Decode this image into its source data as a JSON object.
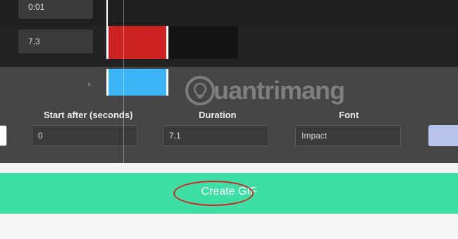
{
  "timeline": {
    "start_time": "0:01",
    "end_time": "7,3"
  },
  "settings": {
    "start_after_label": "Start after (seconds)",
    "start_after_value": "0",
    "duration_label": "Duration",
    "duration_value": "7,1",
    "font_label": "Font",
    "font_value": "Impact",
    "color_swatch": "#b8c4ec"
  },
  "watermark": {
    "text": "uantrimang"
  },
  "actions": {
    "create_gif_label": "Create GIF"
  },
  "colors": {
    "accent_green": "#3edfa4",
    "clip_red": "#cc2222",
    "clip_blue": "#3bb5f5",
    "annotation_red": "#d9201f"
  }
}
